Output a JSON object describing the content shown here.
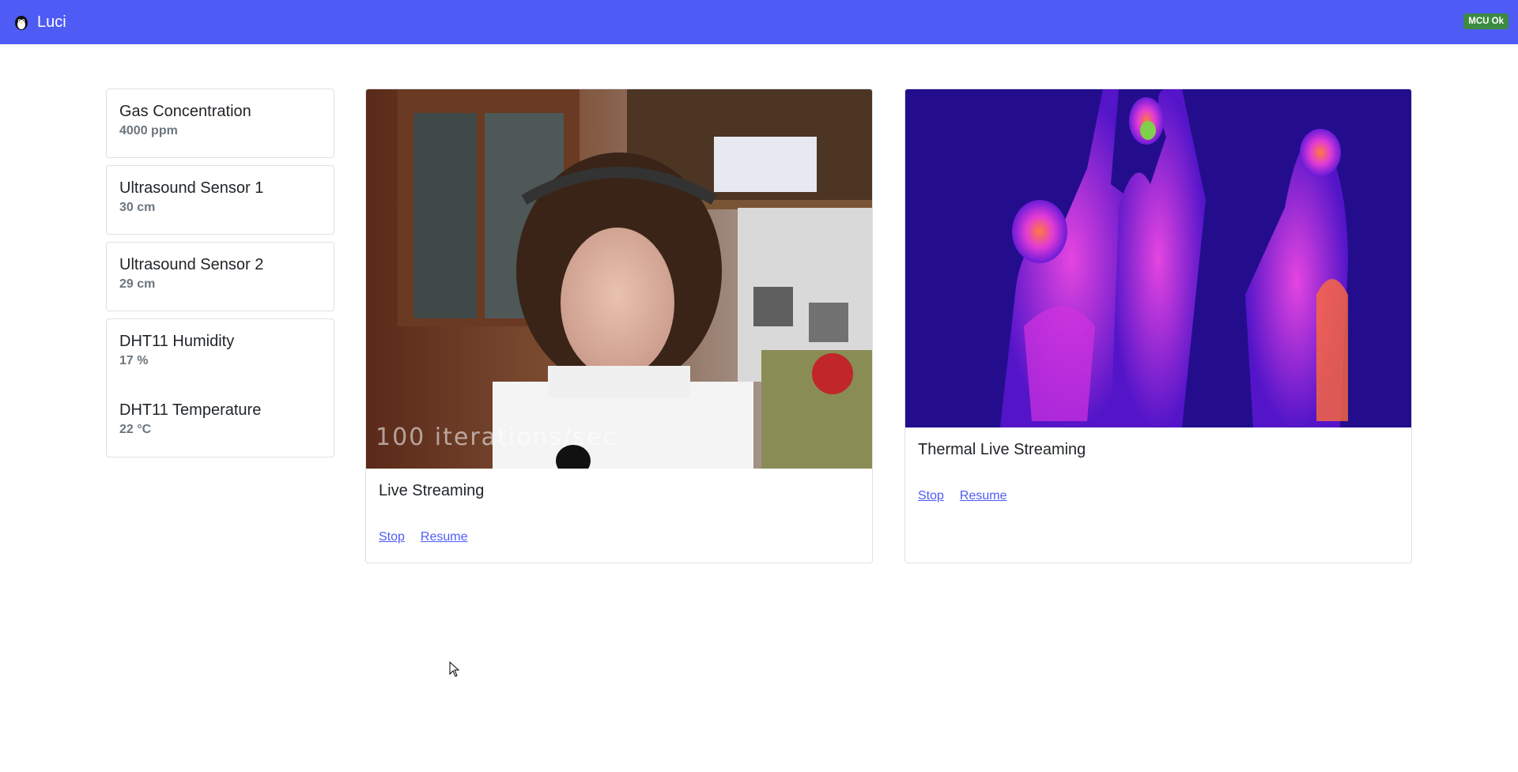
{
  "navbar": {
    "brand": "Luci",
    "status_badge": "MCU Ok",
    "brand_color": "#4f5bf5",
    "badge_color": "#3d8a42"
  },
  "sensors": [
    {
      "label": "Gas Concentration",
      "value": "4000 ppm"
    },
    {
      "label": "Ultrasound Sensor 1",
      "value": "30 cm"
    },
    {
      "label": "Ultrasound Sensor 2",
      "value": "29 cm"
    },
    {
      "label": "DHT11 Humidity",
      "value": "17 %"
    },
    {
      "label": "DHT11 Temperature",
      "value": "22 °C"
    }
  ],
  "streams": [
    {
      "title": "Live Streaming",
      "overlay": "100 iterations/sec",
      "stop_label": "Stop",
      "resume_label": "Resume"
    },
    {
      "title": "Thermal Live Streaming",
      "stop_label": "Stop",
      "resume_label": "Resume"
    }
  ],
  "icons": {
    "logo": "penguin-logo-icon",
    "cursor": "mouse-cursor-icon"
  }
}
